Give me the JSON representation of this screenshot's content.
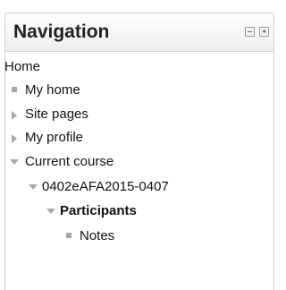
{
  "block": {
    "title": "Navigation",
    "hide_icon": "minus-box-icon",
    "dock_icon": "dock-left-icon"
  },
  "nav": {
    "home": "Home",
    "my_home": "My home",
    "site_pages": "Site pages",
    "my_profile": "My profile",
    "current_course": "Current course",
    "course_code": "0402eAFA2015-0407",
    "participants": "Participants",
    "notes": "Notes"
  }
}
